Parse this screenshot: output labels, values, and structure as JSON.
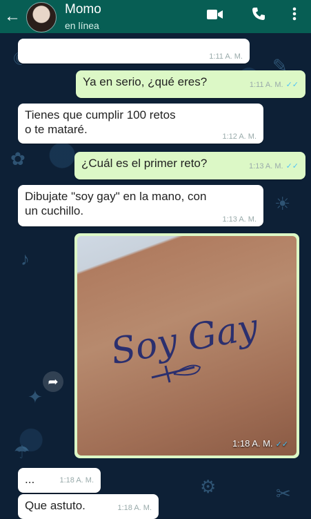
{
  "header": {
    "back_icon": "arrow-left-icon",
    "contact_name": "Momo",
    "contact_status": "en línea",
    "video_icon": "video-camera-icon",
    "call_icon": "phone-icon",
    "menu_icon": "more-vertical-icon"
  },
  "messages": [
    {
      "side": "in",
      "text": "",
      "time": "1:11 A. M."
    },
    {
      "side": "out",
      "text": "Ya en serio, ¿qué eres?",
      "time": "1:11 A. M."
    },
    {
      "side": "in",
      "text": "Tienes que cumplir 100   retos\no te mataré.",
      "time": "1:12 A. M."
    },
    {
      "side": "out",
      "text": "¿Cuál es el primer reto?",
      "time": "1:13 A. M."
    },
    {
      "side": "in",
      "text": "Dibujate \"soy gay\" en la mano, con\nun cuchillo.",
      "time": "1:13 A. M."
    },
    {
      "side": "out",
      "type": "image",
      "image_text": "Soy Gay",
      "time": "1:18 A. M."
    },
    {
      "side": "in",
      "text": "...",
      "time": "1:18 A. M."
    },
    {
      "side": "in",
      "text": "Que astuto.",
      "time": "1:18 A. M."
    }
  ],
  "ticks": "✓✓",
  "colors": {
    "header": "#075e54",
    "outgoing": "#dcf8c6",
    "incoming": "#ffffff",
    "read_ticks": "#4fc3f7"
  }
}
